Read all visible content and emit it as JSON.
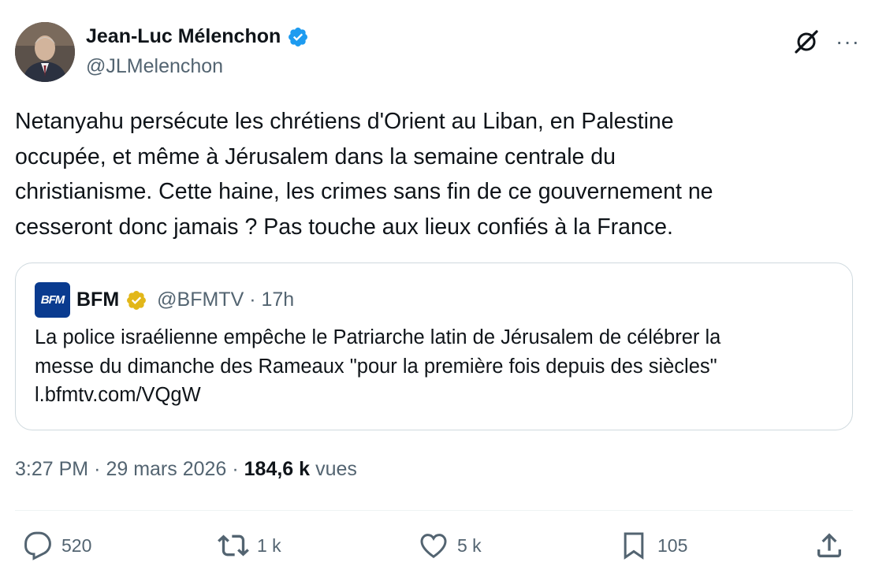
{
  "author": {
    "display_name": "Jean-Luc Mélenchon",
    "handle": "@JLMelenchon",
    "verified_color": "#1d9bf0"
  },
  "tweet": {
    "text": "Netanyahu persécute les chrétiens d'Orient au Liban, en Palestine\noccupée, et même à Jérusalem dans la semaine centrale du\nchristianisme. Cette haine, les crimes sans fin de ce gouvernement ne\ncesseront donc jamais ? Pas touche aux lieux confiés à la France."
  },
  "quote": {
    "logo_text": "BFM",
    "name": "BFM",
    "handle_time": "@BFMTV · 17h",
    "badge_color": "#e2b719",
    "text": "La police israélienne empêche le Patriarche latin de Jérusalem de célébrer la\nmesse du dimanche des Rameaux \"pour la première fois depuis des siècles\"\nl.bfmtv.com/VQgW"
  },
  "meta": {
    "time": "3:27 PM",
    "separator": "·",
    "date": "29 mars 2026",
    "views_count": "184,6 k",
    "views_label": "vues"
  },
  "actions": {
    "replies": "520",
    "reposts": "1 k",
    "likes": "5 k",
    "bookmarks": "105"
  },
  "icons": [
    "verified-badge-icon",
    "grok-icon",
    "more-icon",
    "reply-icon",
    "repost-icon",
    "like-icon",
    "bookmark-icon",
    "share-icon"
  ]
}
